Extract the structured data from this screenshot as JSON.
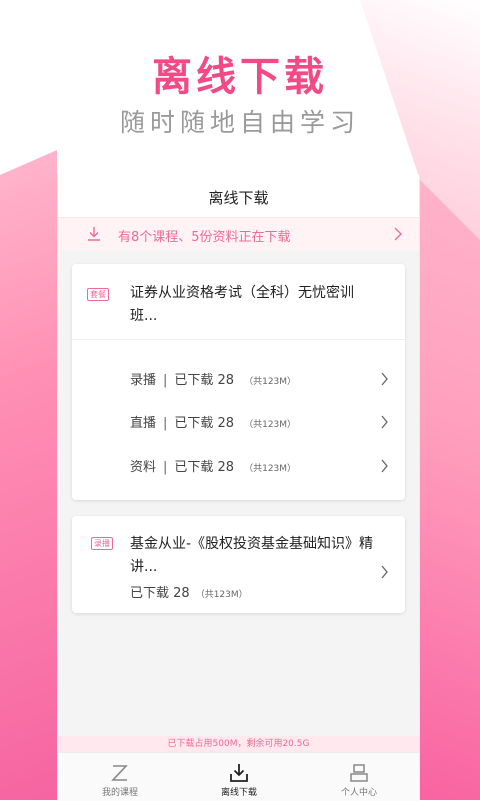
{
  "hero": {
    "title": "离线下载",
    "subtitle": "随时随地自由学习"
  },
  "app": {
    "header_title": "离线下载",
    "notice": "有8个课程、5份资料正在下载"
  },
  "cards": [
    {
      "tag": "套餐",
      "title": "证券从业资格考试（全科）无忧密训班...",
      "rows": [
        {
          "type": "录播",
          "status": "已下载 28",
          "size": "（共123M）"
        },
        {
          "type": "直播",
          "status": "已下载 28",
          "size": "（共123M）"
        },
        {
          "type": "资料",
          "status": "已下载 28",
          "size": "（共123M）"
        }
      ]
    },
    {
      "tag": "录播",
      "title": "基金从业-《股权投资基金基础知识》精讲...",
      "status": "已下载 28",
      "size": "（共123M）"
    }
  ],
  "storage": "已下载占用500M，剩余可用20.5G",
  "tabs": [
    {
      "label": "我的课程",
      "icon": "my-courses-icon"
    },
    {
      "label": "离线下载",
      "icon": "download-icon"
    },
    {
      "label": "个人中心",
      "icon": "profile-icon"
    }
  ],
  "colors": {
    "accent": "#f24a86",
    "notice_bg": "#fff3f6"
  }
}
